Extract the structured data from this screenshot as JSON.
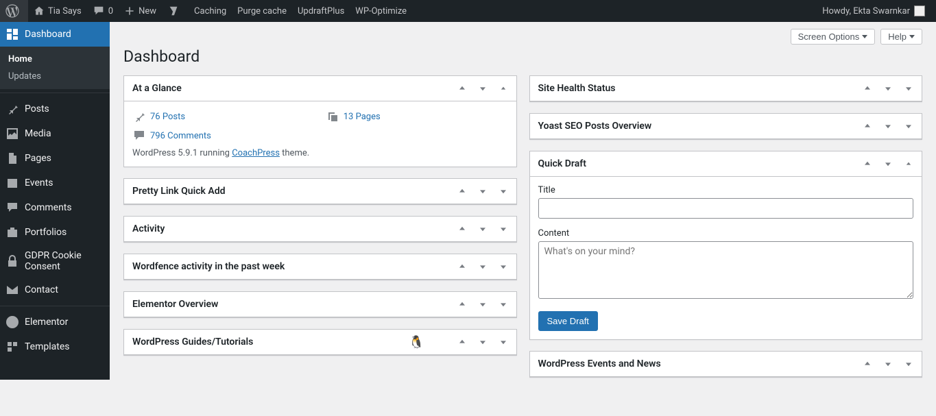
{
  "toolbar": {
    "site_name": "Tia Says",
    "comment_count": "0",
    "new_label": "New",
    "links": [
      "Caching",
      "Purge cache",
      "UpdraftPlus",
      "WP-Optimize"
    ],
    "howdy_prefix": "Howdy, ",
    "user_name": "Ekta Swarnkar"
  },
  "sidebar": {
    "items": [
      {
        "label": "Dashboard",
        "icon": "dashboard",
        "current": true
      },
      {
        "label": "Posts",
        "icon": "pin"
      },
      {
        "label": "Media",
        "icon": "media"
      },
      {
        "label": "Pages",
        "icon": "pages"
      },
      {
        "label": "Events",
        "icon": "calendar"
      },
      {
        "label": "Comments",
        "icon": "comments"
      },
      {
        "label": "Portfolios",
        "icon": "portfolio"
      },
      {
        "label": "GDPR Cookie Consent",
        "icon": "lock"
      },
      {
        "label": "Contact",
        "icon": "mail"
      },
      {
        "label": "Elementor",
        "icon": "elementor"
      },
      {
        "label": "Templates",
        "icon": "templates"
      }
    ],
    "submenu": {
      "items": [
        "Home",
        "Updates"
      ]
    }
  },
  "page": {
    "title": "Dashboard",
    "screen_options": "Screen Options",
    "help": "Help"
  },
  "panels": {
    "left": [
      {
        "title": "At a Glance",
        "type": "glance"
      },
      {
        "title": "Pretty Link Quick Add"
      },
      {
        "title": "Activity"
      },
      {
        "title": "Wordfence activity in the past week"
      },
      {
        "title": "Elementor Overview"
      },
      {
        "title": "WordPress Guides/Tutorials",
        "has_icon": true
      }
    ],
    "right": [
      {
        "title": "Site Health Status"
      },
      {
        "title": "Yoast SEO Posts Overview"
      },
      {
        "title": "Quick Draft",
        "type": "draft"
      },
      {
        "title": "WordPress Events and News"
      }
    ]
  },
  "glance": {
    "posts": "76 Posts",
    "pages": "13 Pages",
    "comments": "796 Comments",
    "version_prefix": "WordPress 5.9.1 running ",
    "theme": "CoachPress",
    "version_suffix": " theme."
  },
  "draft": {
    "title_label": "Title",
    "content_label": "Content",
    "content_placeholder": "What's on your mind?",
    "save_label": "Save Draft"
  }
}
